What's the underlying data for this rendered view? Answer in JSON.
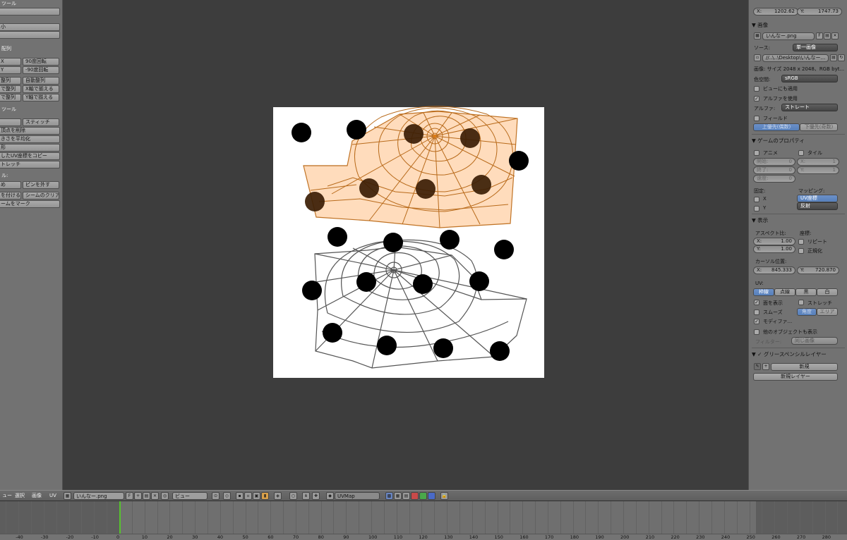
{
  "left_panel": {
    "headers": [
      "ツール",
      "配列",
      "ツール",
      "ル:"
    ],
    "buttons": {
      "b1": "",
      "b2": "小",
      "b3": "",
      "flip_x": "X",
      "rot90": "90度回転",
      "flip_y": "Y",
      "rot_neg90": "-90度回転",
      "align": "整列",
      "auto_align": "自動整列",
      "align_x": "で整列",
      "x_axis": "X軸で揃える",
      "align_y": "で整列",
      "y_axis": "Y軸で揃える",
      "b_empty": "",
      "stitch": "スティッチ",
      "remove_vertex": "頂点を削除",
      "average_size": "きさを平均化",
      "shape": "形",
      "copy_uv": "したUV座標をコピー",
      "stretch": "トレッチ",
      "pin": "め",
      "unpin": "ピンを外す",
      "mark_seam": "を付ける",
      "clear_seam": "シームのクリア",
      "seam_mark": "ームをマーク"
    }
  },
  "right_panel": {
    "cursor_top": {
      "x_label": "X:",
      "x_value": "1202.62",
      "y_label": "Y:",
      "y_value": "1747.73"
    },
    "image_section": {
      "title": "▼ 画像",
      "image_name": "いんなー.png",
      "source_label": "ソース:",
      "source_value": "単一画像",
      "path": "//..\\..\\Desktop\\いんなー...",
      "info": "画像: サイズ 2048 x 2048、RGB byt...",
      "colorspace_label": "色空間:",
      "colorspace_value": "sRGB",
      "view_as_render": "ビューにも適用",
      "use_alpha": "アルファを使用",
      "alpha_label": "アルファ:",
      "alpha_value": "ストレート",
      "fields": "フィールド",
      "upper_first": "上優先(偶数)",
      "lower_first": "下優先(奇数)"
    },
    "game_section": {
      "title": "▼ ゲームのプロパティ",
      "anime": "アニメ",
      "tile": "タイル",
      "start": "開始:",
      "start_val": "0",
      "end": "終了:",
      "end_val": "0",
      "speed": "速度:",
      "speed_val": "0",
      "tx_label": "X:",
      "tx_val": "1",
      "ty_label": "Y:",
      "ty_val": "1",
      "clamp": "固定:",
      "mapping": "マッピング:",
      "cx": "X",
      "cy": "Y",
      "uv_coord": "UV座標",
      "reflect": "反射"
    },
    "display_section": {
      "title": "▼ 表示",
      "aspect": "アスペクト比:",
      "coords": "座標:",
      "ax_label": "X:",
      "ax_val": "1.00",
      "ay_label": "Y:",
      "ay_val": "1.00",
      "repeat": "リピート",
      "normalized": "正規化",
      "cursor_pos": "カーソル位置:",
      "cx_label": "X:",
      "cx_val": "845.333",
      "cy_label": "Y:",
      "cy_val": "720.870",
      "uv": "UV:",
      "uv_buttons": [
        "枠線",
        "点線",
        "黒",
        "白"
      ],
      "draw_faces": "面を表示",
      "stretch": "ストレッチ",
      "smooth": "スムーズ",
      "angle": "角度",
      "area": "エリア",
      "modifier": "モディファ...",
      "other_objects": "他のオブジェクトも表示",
      "filter_label": "フィルター:",
      "filter_value": "同じ画像"
    },
    "grease_section": {
      "title": "▼ ✓ グリースペンシルレイヤー",
      "new": "新規",
      "new_layer": "新規レイヤー"
    }
  },
  "header_bar": {
    "menu_view": "ュー",
    "menu_select": "選択",
    "menu_image": "画像",
    "menu_uv": "UV",
    "image_name": "いんなー.png",
    "image_flag": "F",
    "mode": "ビュー",
    "uvmap": "UVMap"
  },
  "timeline": {
    "ticks": [
      "-40",
      "-30",
      "-20",
      "-10",
      "0",
      "10",
      "20",
      "30",
      "40",
      "50",
      "60",
      "70",
      "80",
      "90",
      "100",
      "110",
      "120",
      "130",
      "140",
      "150",
      "160",
      "170",
      "180",
      "190",
      "200",
      "210",
      "220",
      "230",
      "240",
      "250",
      "260",
      "270",
      "280"
    ],
    "accent_color": "#57c22f"
  },
  "colors": {
    "viewport_bg": "#3d3d3d",
    "panel_bg": "#727272",
    "selected_face": "#ffd9b8",
    "selected_edge": "#b86a1a",
    "unselected_edge": "#555555",
    "active_button": "#5680bb"
  }
}
